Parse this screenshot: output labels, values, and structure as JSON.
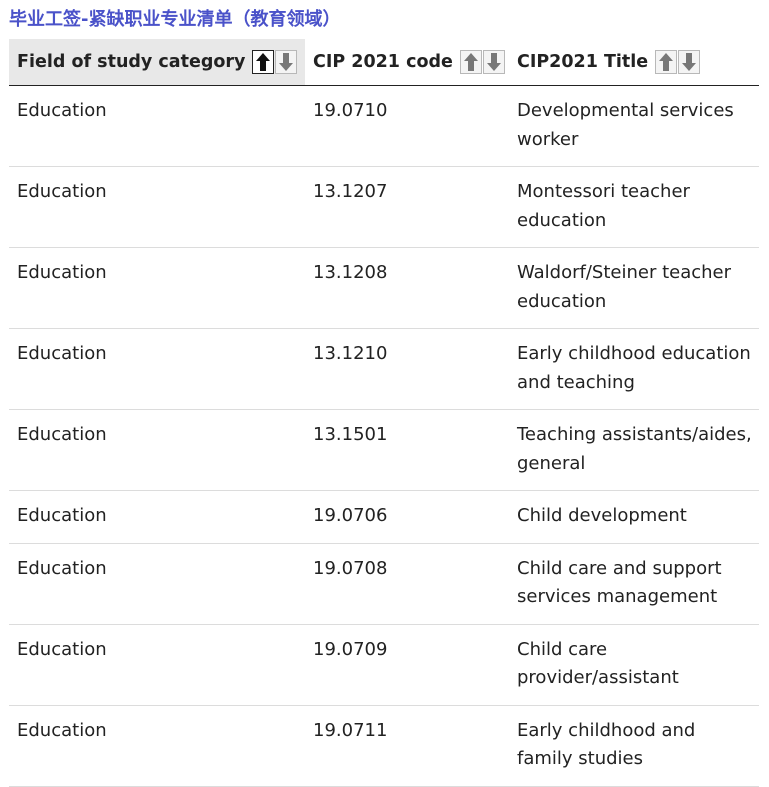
{
  "page": {
    "title": "毕业工签-紧缺职业专业清单（教育领域）"
  },
  "table": {
    "columns": [
      {
        "label": "Field of study category",
        "sort_up": "sort-ascending",
        "sort_down": "sort-descending",
        "active_sort": "ascending"
      },
      {
        "label": "CIP 2021 code",
        "sort_up": "sort-ascending",
        "sort_down": "sort-descending",
        "active_sort": ""
      },
      {
        "label": "CIP2021 Title",
        "sort_up": "sort-ascending",
        "sort_down": "sort-descending",
        "active_sort": ""
      }
    ],
    "rows": [
      {
        "category": "Education",
        "code": "19.0710",
        "title": "Developmental services worker"
      },
      {
        "category": "Education",
        "code": "13.1207",
        "title": "Montessori teacher education"
      },
      {
        "category": "Education",
        "code": "13.1208",
        "title": "Waldorf/Steiner teacher education"
      },
      {
        "category": "Education",
        "code": "13.1210",
        "title": "Early childhood education and teaching"
      },
      {
        "category": "Education",
        "code": "13.1501",
        "title": "Teaching assistants/aides, general"
      },
      {
        "category": "Education",
        "code": "19.0706",
        "title": "Child development"
      },
      {
        "category": "Education",
        "code": "19.0708",
        "title": "Child care and support services management"
      },
      {
        "category": "Education",
        "code": "19.0709",
        "title": "Child care provider/assistant"
      },
      {
        "category": "Education",
        "code": "19.0711",
        "title": "Early childhood and family studies"
      }
    ]
  },
  "colors": {
    "title": "#4a52c9",
    "header_active_bg": "#e8e8e8",
    "row_divider": "#dcdcdc",
    "header_divider": "#222222"
  }
}
